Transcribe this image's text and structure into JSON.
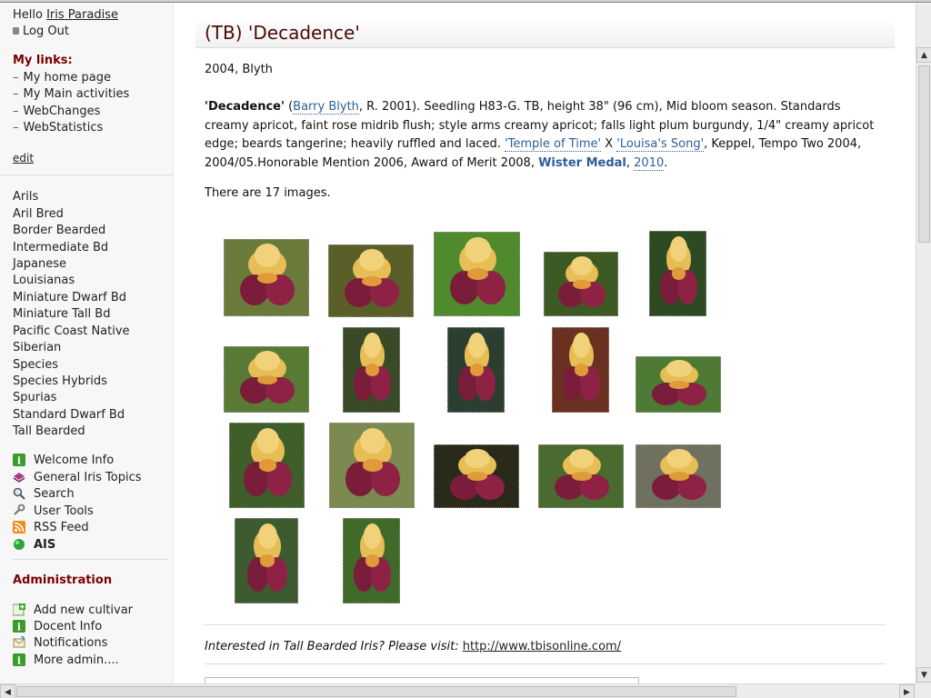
{
  "sidebar": {
    "hello_prefix": "Hello",
    "user_name": "Iris Paradise",
    "logout": "Log Out",
    "my_links_heading": "My links:",
    "my_links": [
      "My home page",
      "My Main activities",
      "WebChanges",
      "WebStatistics"
    ],
    "edit": "edit",
    "categories": [
      "Arils",
      "Aril Bred",
      "Border Bearded",
      "Intermediate Bd",
      "Japanese",
      "Louisianas",
      "Miniature Dwarf Bd",
      "Miniature Tall Bd",
      "Pacific Coast Native",
      "Siberian",
      "Species",
      "Species Hybrids",
      "Spurias",
      "Standard Dwarf Bd",
      "Tall Bearded"
    ],
    "tools": [
      "Welcome Info",
      "General Iris Topics",
      "Search",
      "User Tools",
      "RSS Feed",
      "AIS"
    ],
    "admin_heading": "Administration",
    "admin": [
      "Add new cultivar",
      "Docent Info",
      "Notifications",
      "More admin...."
    ]
  },
  "main": {
    "title": "(TB) 'Decadence'",
    "subtitle": "2004, Blyth",
    "desc": {
      "name": "'Decadence'",
      "open": " (",
      "hybridizer": "Barry Blyth",
      "t1": ", R. 2001). Seedling H83-G. TB, height 38\" (96 cm), Mid bloom season. Standards creamy apricot, faint rose midrib flush; style arms creamy apricot; falls light plum burgundy, 1/4\" creamy apricot edge; beards tangerine; heavily ruffled and laced. ",
      "parent1": "'Temple of Time'",
      "x": " X ",
      "parent2": "'Louisa's Song'",
      "t2": ", Keppel, Tempo Two 2004, 2004/05.Honorable Mention 2006, Award of Merit 2008, ",
      "medal": "Wister Medal",
      "comma": ", ",
      "year": "2010",
      "end": "."
    },
    "image_count": "There are 17 images.",
    "footer_prefix": "Interested in Tall Bearded Iris? Please visit: ",
    "footer_link": "http://www.tbisonline.com/"
  },
  "colors": {
    "accent": "#7a0000",
    "link": "#2f5d9b",
    "sidebar_bg": "#f7f7f7"
  }
}
